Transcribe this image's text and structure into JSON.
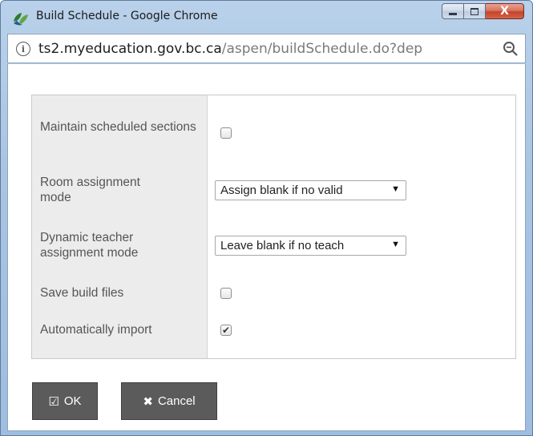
{
  "window": {
    "title": "Build Schedule - Google Chrome",
    "controls": {
      "minimize_icon": "minimize-icon",
      "maximize_icon": "maximize-icon",
      "close_glyph": "X"
    }
  },
  "address_bar": {
    "info_glyph": "i",
    "url_host": "ts2.myeducation.gov.bc.ca",
    "url_path": "/aspen/buildSchedule.do?dep",
    "zoom_icon": "zoom-icon"
  },
  "form": {
    "fields": [
      {
        "label": "Maintain scheduled sections",
        "type": "checkbox",
        "checked": false
      },
      {
        "label": "Room assignment mode",
        "type": "select",
        "value": "Assign blank if no valid"
      },
      {
        "label": "Dynamic teacher assignment mode",
        "type": "select",
        "value": "Leave blank if no teach"
      },
      {
        "label": "Save build files",
        "type": "checkbox",
        "checked": false
      },
      {
        "label": "Automatically import",
        "type": "checkbox",
        "checked": true
      }
    ],
    "checkmark": "✔",
    "select_arrow": "▼"
  },
  "buttons": {
    "ok": {
      "label": "OK",
      "icon": "checkbox-check-icon",
      "glyph": "☑"
    },
    "cancel": {
      "label": "Cancel",
      "icon": "close-x-icon",
      "glyph": "✖"
    }
  },
  "colors": {
    "title_bar": "#a9c4e2",
    "close_button": "#c4432a",
    "label_panel": "#ececec",
    "button_bg": "#5b5b5b"
  }
}
